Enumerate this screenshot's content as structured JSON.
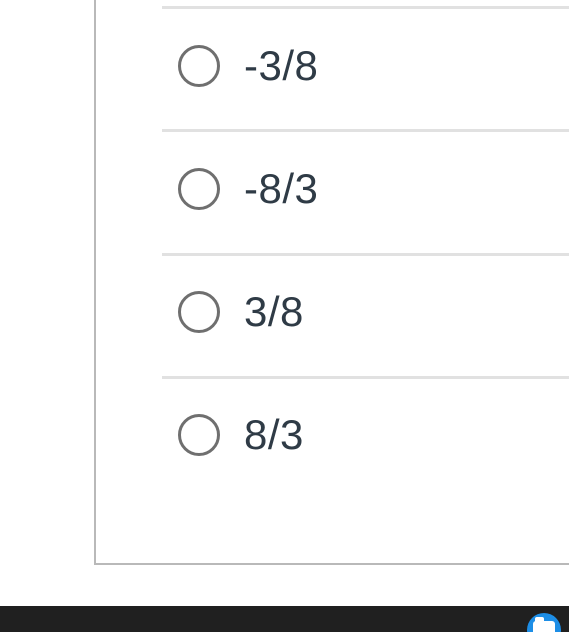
{
  "question": {
    "options": [
      {
        "label": "-3/8",
        "selected": false
      },
      {
        "label": "-8/3",
        "selected": false
      },
      {
        "label": "3/8",
        "selected": false
      },
      {
        "label": "8/3",
        "selected": false
      }
    ]
  },
  "taskbar": {
    "app_icon": "folder-icon",
    "app_icon_color": "#1d8ee6"
  }
}
